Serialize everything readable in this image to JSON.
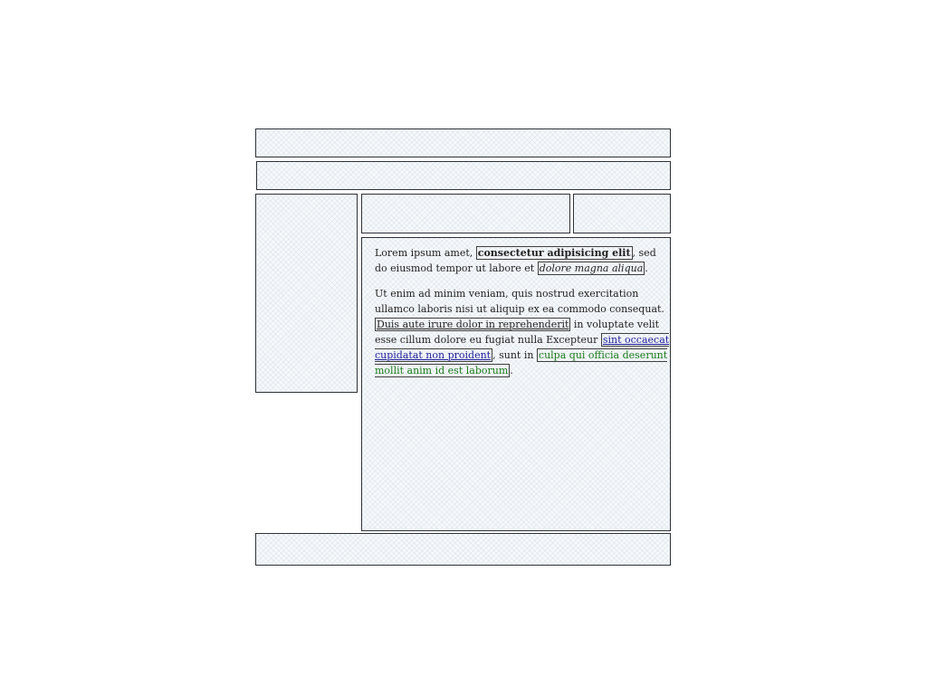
{
  "main": {
    "paragraph_1": {
      "text_1": "Lorem ipsum amet, ",
      "bold_text": "consectetur adipisicing elit",
      "text_2": ", sed do eiusmod tempor ut labore et ",
      "italic_text": "dolore magna aliqua",
      "text_3": "."
    },
    "paragraph_2": {
      "text_1": "Ut enim ad minim veniam, quis nostrud exercitation ullamco laboris nisi ut aliquip ex ea commodo consequat. ",
      "underlined_text": "Duis aute irure dolor in reprehenderit",
      "text_2": " in voluptate velit esse cillum dolore eu fugiat nulla Excepteur ",
      "link_text": "sint occaecat cupidatat non proident",
      "text_3": ", sunt in ",
      "green_text": "culpa qui officia deserunt mollit anim id est laborum",
      "text_4": "."
    }
  },
  "colors": {
    "border": "#2d3238",
    "panel_fill": "#f6f8fa",
    "text": "#1f1f1f",
    "link": "#1f1f9a",
    "green_text": "#1b7a1b"
  }
}
